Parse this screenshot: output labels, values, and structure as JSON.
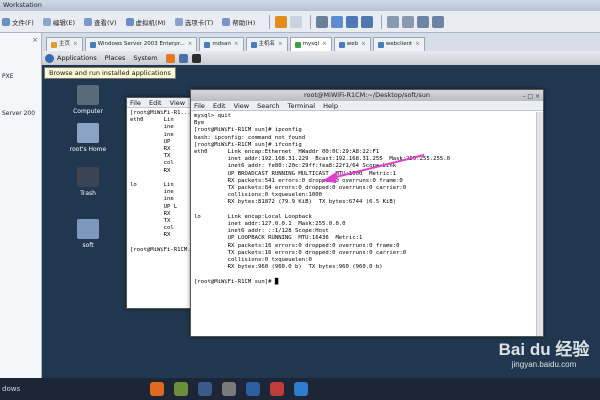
{
  "vm": {
    "title_fragment": "Workstation",
    "menus": [
      "文件(F)",
      "编辑(E)",
      "查看(V)",
      "虚拟机(M)",
      "选项卡(T)",
      "帮助(H)"
    ],
    "library": {
      "title": "",
      "entries": [
        "PXE",
        "Server 200"
      ]
    }
  },
  "tabs": [
    {
      "label": "主页"
    },
    {
      "label": "Windows Server 2003 Enterpr..."
    },
    {
      "label": "mdsan"
    },
    {
      "label": "主机名"
    },
    {
      "label": "mysql",
      "active": true
    },
    {
      "label": "web"
    },
    {
      "label": "webclient"
    }
  ],
  "guest": {
    "panel": {
      "apps": "Applications",
      "places": "Places",
      "system": "System"
    },
    "tooltip": "Browse and run installed applications",
    "desktop_icons": [
      "Computer",
      "root's Home",
      "Trash",
      "soft"
    ]
  },
  "term_back": {
    "menu": [
      "File",
      "Edit",
      "View"
    ],
    "lines": [
      "[root@MiWiFi-R1...",
      "eth0      Lin",
      "          ine",
      "          ine",
      "          UP",
      "          RX",
      "          TX",
      "          col",
      "          RX",
      "",
      "lo        Lin",
      "          ine",
      "          ine",
      "          UP L",
      "          RX",
      "          TX",
      "          col",
      "          RX",
      "",
      "[root@MiWiFi-R1CM..."
    ]
  },
  "term_front": {
    "title": "root@MiWiFi-R1CM:~/Desktop/soft/sun",
    "menu": [
      "File",
      "Edit",
      "View",
      "Search",
      "Terminal",
      "Help"
    ],
    "lines": [
      "mysql> quit",
      "Bye",
      "[root@MiWiFi-R1CM sun]# ipconfig",
      "bash: ipconfig: command not found",
      "[root@MiWiFi-R1CM sun]# ifconfig",
      "eth0      Link encap:Ethernet  HWaddr 00:0C:29:A8:22:F1",
      "          inet addr:192.168.31.229  Bcast:192.168.31.255  Mask:255.255.255.0",
      "          inet6 addr: fe80::20c:29ff:fea8:22f1/64 Scope:Link",
      "          UP BROADCAST RUNNING MULTICAST  MTU:1500  Metric:1",
      "          RX packets:541 errors:0 dropped:0 overruns:0 frame:0",
      "          TX packets:84 errors:0 dropped:0 overruns:0 carrier:0",
      "          collisions:0 txqueuelen:1000",
      "          RX bytes:81872 (79.9 KiB)  TX bytes:6744 (6.5 KiB)",
      "",
      "lo        Link encap:Local Loopback",
      "          inet addr:127.0.0.1  Mask:255.0.0.0",
      "          inet6 addr: ::1/128 Scope:Host",
      "          UP LOOPBACK RUNNING  MTU:16436  Metric:1",
      "          RX packets:16 errors:0 dropped:0 overruns:0 frame:0",
      "          TX packets:16 errors:0 dropped:0 overruns:0 carrier:0",
      "          collisions:0 txqueuelen:0",
      "          RX bytes:960 (960.0 b)  TX bytes:960 (960.0 b)",
      "",
      "[root@MiWiFi-R1CM sun]# "
    ]
  },
  "taskbar": {
    "start_label": "dows"
  },
  "watermark": {
    "brand": "Bai du 经验",
    "url": "jingyan.baidu.com"
  },
  "colors": {
    "annotation_arrow": "#e040d0",
    "desktop": "#20374f"
  }
}
